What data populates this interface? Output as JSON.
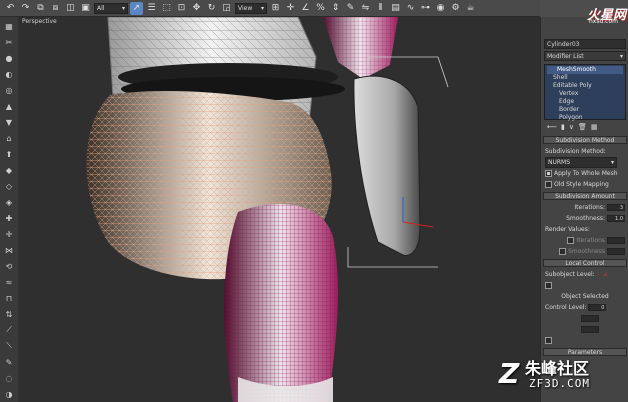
{
  "toolbar": {
    "selection_filter": "All",
    "reference_coord": "View",
    "icons": [
      "undo-icon",
      "redo-icon",
      "link-icon",
      "unlink-icon",
      "bind-icon",
      "filter-icon",
      "select-icon",
      "select-by-name-icon",
      "region-select-icon",
      "window-crossing-icon",
      "move-icon",
      "rotate-icon",
      "scale-icon",
      "pivot-icon",
      "snap-icon",
      "angle-snap-icon",
      "percent-snap-icon",
      "spinner-snap-icon",
      "named-selection-icon",
      "mirror-icon",
      "align-icon",
      "layers-icon",
      "curve-editor-icon",
      "schematic-icon",
      "material-editor-icon",
      "render-setup-icon",
      "render-icon"
    ]
  },
  "viewport": {
    "label": "Perspective"
  },
  "panel": {
    "object_name": "Cylinder03",
    "modifier_list": "Modifier List",
    "stack": [
      {
        "label": "MeshSmooth",
        "kind": "top"
      },
      {
        "label": "Shell",
        "kind": "item"
      },
      {
        "label": "Editable Poly",
        "kind": "item"
      },
      {
        "label": "Vertex",
        "kind": "sub"
      },
      {
        "label": "Edge",
        "kind": "sub"
      },
      {
        "label": "Border",
        "kind": "sub"
      },
      {
        "label": "Polygon",
        "kind": "sub"
      }
    ],
    "subdivision_method_title": "Subdivision Method",
    "subdivision_method_label": "Subdivision Method:",
    "subdivision_method_value": "NURMS",
    "apply_to_whole_mesh": "Apply To Whole Mesh",
    "old_style_mapping": "Old Style Mapping",
    "subdivision_amount_title": "Subdivision Amount",
    "iterations_label": "Iterations:",
    "iterations_value": "3",
    "smoothness_label": "Smoothness:",
    "smoothness_value": "1.0",
    "render_values_label": "Render Values:",
    "render_iterations_label": "Iterations",
    "render_smoothness_label": "Smoothness",
    "local_control_title": "Local Control",
    "subobject_level_label": "Subobject Level:",
    "object_selected": "Object Selected",
    "control_level_label": "Control Level:",
    "control_level_value": "0",
    "parameters_title": "Parameters"
  },
  "watermarks": {
    "top_logo": "火星网",
    "top_url": "hxsd.com",
    "bottom_cn": "朱峰社区",
    "bottom_url": "ZF3D.COM"
  },
  "colors": {
    "accent": "#5b87c5",
    "mesh_pink": "#c8246e",
    "wire_orange": "#e08a5a"
  }
}
